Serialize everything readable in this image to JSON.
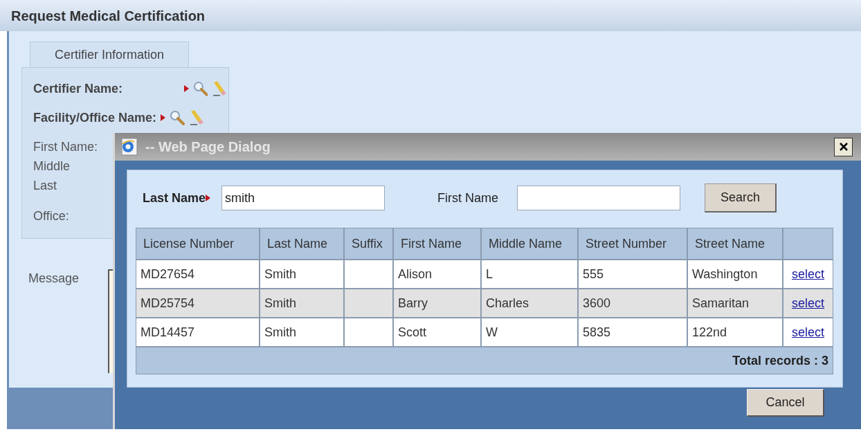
{
  "page": {
    "title": "Request Medical Certification"
  },
  "tabs": [
    {
      "label": "Certifier Information",
      "selected": true
    }
  ],
  "lookup_fields": [
    {
      "label": "Certifier Name:",
      "required": true
    },
    {
      "label": "Facility/Office Name:",
      "required": true
    }
  ],
  "detail_labels": [
    "First Name:",
    "Middle",
    "Last",
    "Office:"
  ],
  "message_label": "Message",
  "dialog": {
    "title": "-- Web Page Dialog",
    "filters": [
      {
        "label": "Last Name",
        "required": true,
        "value": "smith"
      },
      {
        "label": "First Name",
        "required": false
      }
    ],
    "search_button": "Search",
    "columns": [
      "License Number",
      "Last Name",
      "Suffix",
      "First Name",
      "Middle Name",
      "Street Number",
      "Street Name"
    ],
    "rows": [
      {
        "cells": [
          "MD27654",
          "Smith",
          null,
          "Alison",
          "L",
          "555",
          "Washington"
        ],
        "action": "select"
      },
      {
        "cells": [
          "MD25754",
          "Smith",
          null,
          "Barry",
          "Charles",
          "3600",
          "Samaritan"
        ],
        "action": "select"
      },
      {
        "cells": [
          "MD14457",
          "Smith",
          null,
          "Scott",
          "W",
          "5835",
          "122nd"
        ],
        "action": "select"
      }
    ],
    "footer": "Total records : 3",
    "cancel_button": "Cancel"
  }
}
